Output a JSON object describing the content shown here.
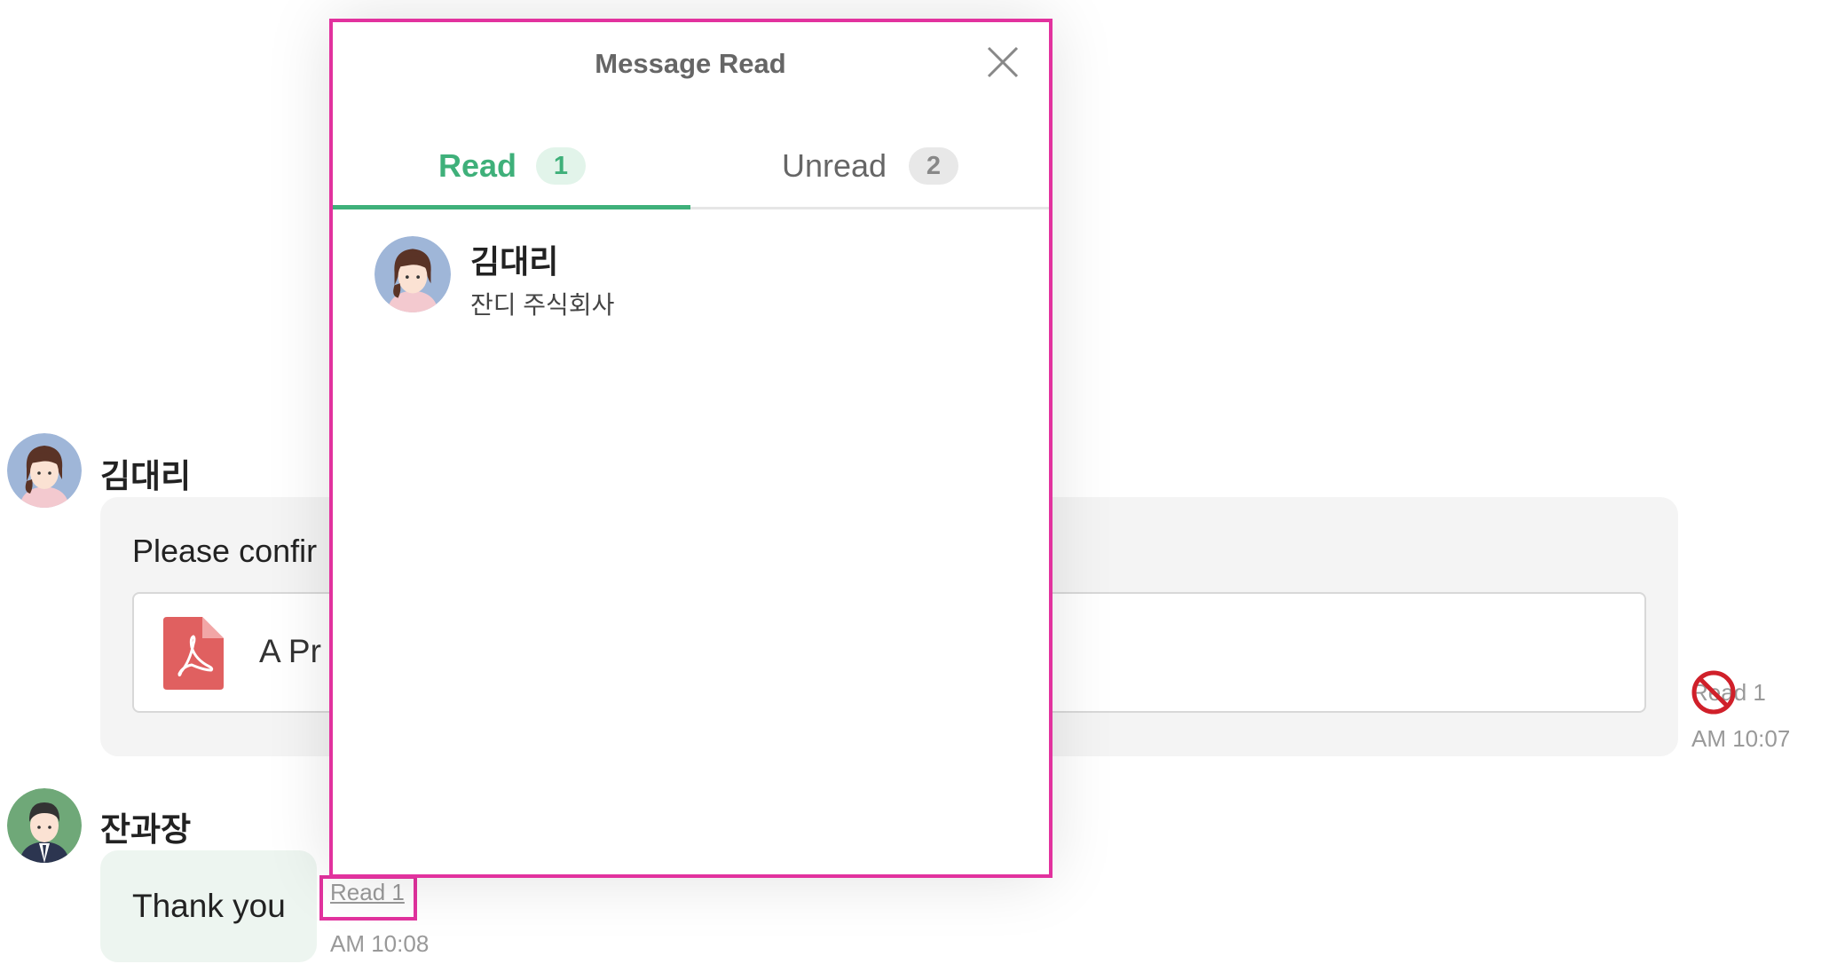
{
  "messages": [
    {
      "sender": "김대리",
      "text": "Please confir",
      "attachment": {
        "icon": "pdf-file-icon",
        "name": "A Pr"
      },
      "read_label": "Read 1",
      "time": "AM 10:07"
    },
    {
      "sender": "잔과장",
      "text": "Thank you",
      "read_label": "Read 1",
      "time": "AM 10:08"
    }
  ],
  "modal": {
    "title": "Message Read",
    "close_icon": "close-icon",
    "tabs": [
      {
        "label": "Read",
        "count": "1",
        "active": true
      },
      {
        "label": "Unread",
        "count": "2",
        "active": false
      }
    ],
    "members": [
      {
        "name": "김대리",
        "company": "잔디 주식회사"
      }
    ]
  },
  "colors": {
    "accent_green": "#3fb07a",
    "highlight_pink": "#e2329e",
    "pdf_red": "#e06060",
    "no_sign_red": "#d0202a"
  }
}
